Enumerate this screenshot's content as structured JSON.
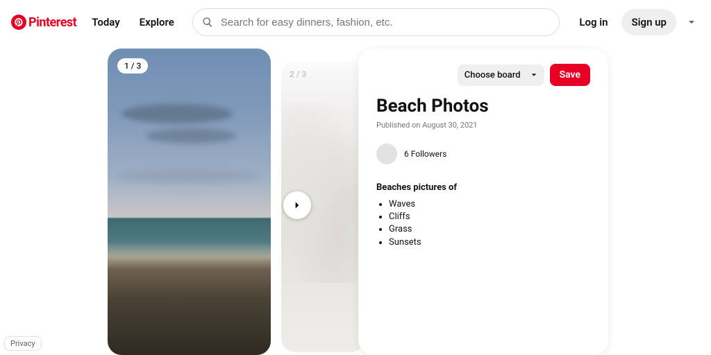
{
  "header": {
    "brand": "Pinterest",
    "nav": {
      "today": "Today",
      "explore": "Explore"
    },
    "search_placeholder": "Search for easy dinners, fashion, etc.",
    "login": "Log in",
    "signup": "Sign up"
  },
  "carousel": {
    "badge_current": "1 / 3",
    "badge_next": "2 / 3"
  },
  "pin": {
    "choose_board": "Choose board",
    "save": "Save",
    "title": "Beach Photos",
    "published": "Published on August 30, 2021",
    "followers": "6 Followers",
    "list_heading": "Beaches pictures of",
    "items": [
      "Waves",
      "Cliffs",
      "Grass",
      "Sunsets"
    ]
  },
  "footer": {
    "privacy": "Privacy"
  }
}
